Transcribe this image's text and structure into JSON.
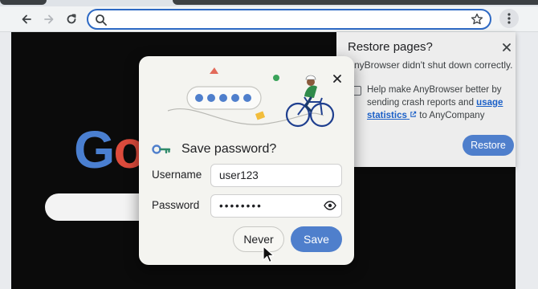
{
  "browser": {
    "omnibox": {
      "value": "",
      "placeholder": ""
    },
    "icons": [
      "back-arrow-icon",
      "forward-arrow-icon",
      "reload-icon",
      "search-icon",
      "bookmark-star-icon",
      "menu-dots-icon"
    ]
  },
  "page": {
    "logo_letters": [
      {
        "ch": "G",
        "color": "#4a7fd0"
      },
      {
        "ch": "o",
        "color": "#dd4b3c"
      }
    ]
  },
  "restore_panel": {
    "title": "Restore pages?",
    "message": "AnyBrowser didn't shut down correctly.",
    "help_prefix": "Help make AnyBrowser better by sending crash reports and ",
    "help_link": "usage statistics",
    "help_suffix": " to AnyCompany",
    "restore_label": "Restore",
    "checkbox_checked": false
  },
  "save_dialog": {
    "title": "Save password?",
    "username_label": "Username",
    "username_value": "user123",
    "password_label": "Password",
    "password_value": "••••••••",
    "never_label": "Never",
    "save_label": "Save"
  },
  "colors": {
    "accent": "#4f7fcc",
    "omnibox_border": "#2d69c4",
    "link": "#1a5fc7",
    "page_bg": "#0b0b0b"
  }
}
